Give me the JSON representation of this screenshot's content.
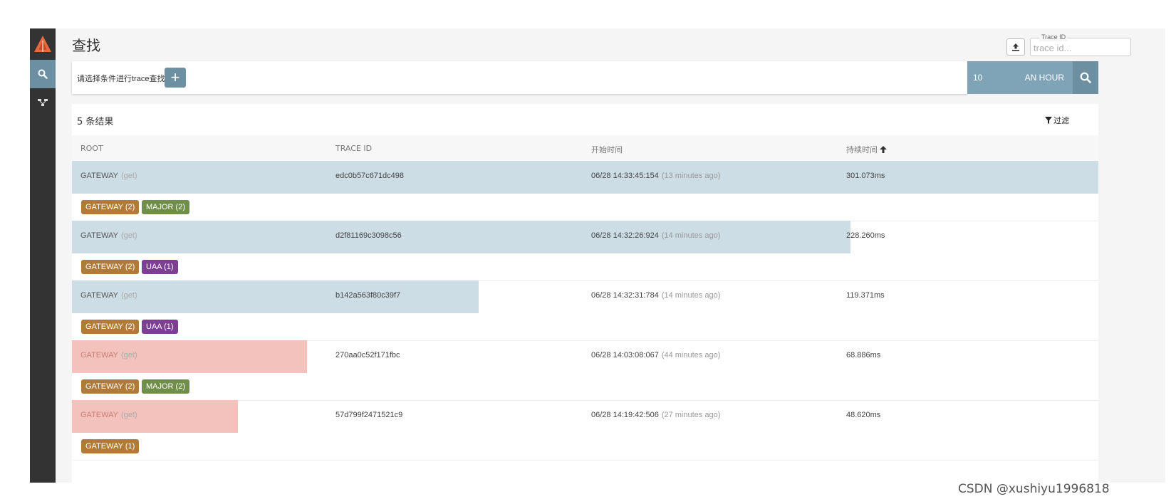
{
  "page": {
    "title": "查找"
  },
  "trace_search": {
    "legend": "Trace ID",
    "placeholder": "trace id...",
    "value": ""
  },
  "query": {
    "hint": "请选择条件进行trace查找",
    "add_label": "+",
    "limit": "10",
    "range": "AN HOUR"
  },
  "results": {
    "count_label": "5 条结果",
    "filter_label": "过滤",
    "columns": [
      "ROOT",
      "TRACE ID",
      "开始时间",
      "持续时间"
    ],
    "sort_column": "持续时间",
    "max_duration_ms": 301.073,
    "rows": [
      {
        "service": "GATEWAY",
        "method": "(get)",
        "trace_id": "edc0b57c671dc498",
        "start": "06/28 14:33:45:154",
        "ago": "(13 minutes ago)",
        "duration": "301.073ms",
        "duration_ms": 301.073,
        "error": false,
        "tags": [
          {
            "label": "GATEWAY (2)",
            "color": "#b07a3a"
          },
          {
            "label": "MAJOR (2)",
            "color": "#6f8e4a"
          }
        ]
      },
      {
        "service": "GATEWAY",
        "method": "(get)",
        "trace_id": "d2f81169c3098c56",
        "start": "06/28 14:32:26:924",
        "ago": "(14 minutes ago)",
        "duration": "228.260ms",
        "duration_ms": 228.26,
        "error": false,
        "tags": [
          {
            "label": "GATEWAY (2)",
            "color": "#b07a3a"
          },
          {
            "label": "UAA (1)",
            "color": "#7d3f92"
          }
        ]
      },
      {
        "service": "GATEWAY",
        "method": "(get)",
        "trace_id": "b142a563f80c39f7",
        "start": "06/28 14:32:31:784",
        "ago": "(14 minutes ago)",
        "duration": "119.371ms",
        "duration_ms": 119.371,
        "error": false,
        "tags": [
          {
            "label": "GATEWAY (2)",
            "color": "#b07a3a"
          },
          {
            "label": "UAA (1)",
            "color": "#7d3f92"
          }
        ]
      },
      {
        "service": "GATEWAY",
        "method": "(get)",
        "trace_id": "270aa0c52f171fbc",
        "start": "06/28 14:03:08:067",
        "ago": "(44 minutes ago)",
        "duration": "68.886ms",
        "duration_ms": 68.886,
        "error": true,
        "tags": [
          {
            "label": "GATEWAY (2)",
            "color": "#b07a3a"
          },
          {
            "label": "MAJOR (2)",
            "color": "#6f8e4a"
          }
        ]
      },
      {
        "service": "GATEWAY",
        "method": "(get)",
        "trace_id": "57d799f2471521c9",
        "start": "06/28 14:19:42:506",
        "ago": "(27 minutes ago)",
        "duration": "48.620ms",
        "duration_ms": 48.62,
        "error": true,
        "tags": [
          {
            "label": "GATEWAY (1)",
            "color": "#b07a3a"
          }
        ]
      }
    ]
  },
  "icons": {
    "logo": "zipkin-logo-icon",
    "nav_search": "search-icon",
    "nav_dependencies": "dependency-tree-icon",
    "upload": "upload-icon",
    "search_submit": "search-icon",
    "filter": "filter-icon",
    "sort": "arrow-up-icon"
  },
  "colors": {
    "sidebar": "#333333",
    "accent": "#6c8fa1",
    "bar_normal": "#cddde5",
    "bar_error": "#f4c2bd"
  },
  "watermark": "CSDN @xushiyu1996818"
}
